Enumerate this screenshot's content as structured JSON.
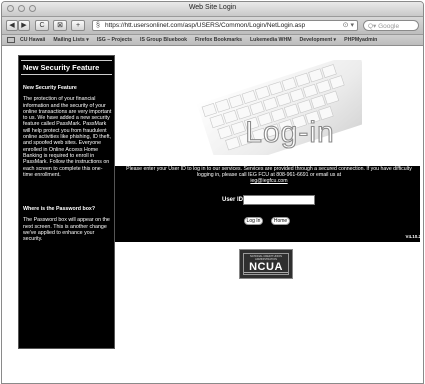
{
  "window": {
    "title": "Web Site Login"
  },
  "toolbar": {
    "back": "◀",
    "forward": "▶",
    "reload": "C",
    "stop": "⊠",
    "add": "+",
    "url": "https://htt.usersonlinet.com/asp/USERS/Common/Login/NetLogin.asp",
    "url_right": "⊙ ▾",
    "search_placeholder": "Q▾ Google"
  },
  "bookmarks": [
    "CU Hawaii",
    "Mailing Lists ▾",
    "ISG – Projects",
    "IS Group Bluebook",
    "Firefox Bookmarks",
    "Lukemedia WHM",
    "Development ▾",
    "PHPMyadmin"
  ],
  "sidebar": {
    "title": "New Security Feature",
    "section1_heading": "New Security Feature",
    "section1_body": "The protection of your financial information and the security of your online transactions are very important to us. We have added a new security feature called PassMark. PassMark will help protect you from fraudulent online activities like phishing, ID theft, and spoofed web sites. Everyone enrolled in Online Access Home Banking is required to enroll in PassMark. Follow the instructions on each screen to complete this one-time enrollment.",
    "section2_heading": "Where is the Password box?",
    "section2_body": "The Password box will appear on the next screen. This is another change we've applied to enhance your security."
  },
  "hero": {
    "text": "Log-in"
  },
  "login": {
    "instructions": "Please enter your User ID to log in to our services. Services are provided through a secured connection. If you have difficulty logging in, please call  IEG FCU at  808-961-6691 or email us at",
    "email": "ieg@iegfcu.com",
    "user_id_label": "User ID",
    "user_id_value": "",
    "login_button": "Log In",
    "home_button": "Home",
    "version": "V4.10.2"
  },
  "ncua": {
    "top_text": "NATIONAL CREDIT UNION ADMINISTRATION",
    "main_text": "NCUA"
  },
  "colors": {
    "band": "#000000",
    "sidebar": "#000000",
    "ncua": "#2f2f2f"
  }
}
